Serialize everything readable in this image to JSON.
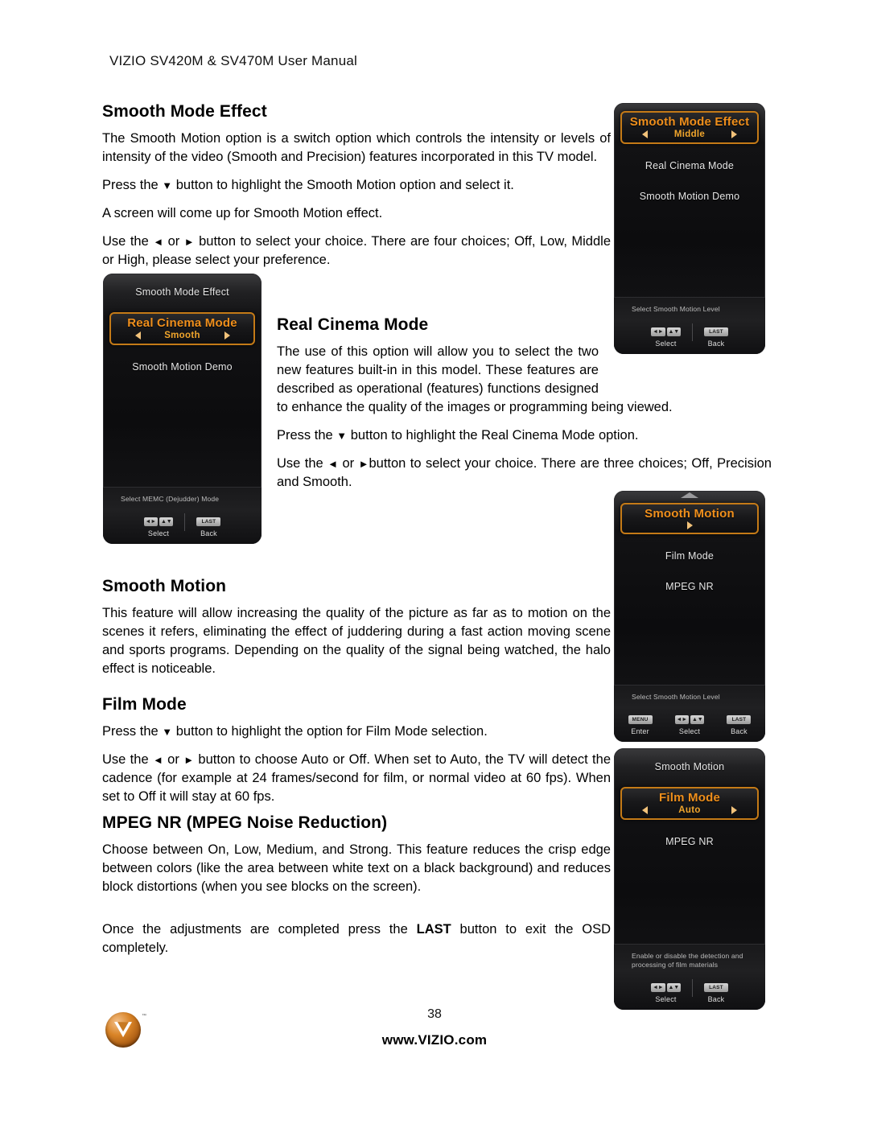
{
  "header": {
    "title": "VIZIO SV420M & SV470M User Manual"
  },
  "sections": {
    "smooth_mode_effect": {
      "heading": "Smooth Mode Effect",
      "p1": "The Smooth Motion option is a switch option which controls the intensity or levels of intensity of the video (Smooth and Precision) features incorporated in this TV model.",
      "p2_pre": "Press the ",
      "p2_post": " button to highlight the Smooth Motion option and select it.",
      "p3": "A screen will come up for Smooth Motion effect.",
      "p4_pre": "Use the ",
      "p4_mid": " or ",
      "p4_post": " button to select your choice. There are four choices; Off, Low, Middle or High, please select your preference."
    },
    "real_cinema_mode": {
      "heading": "Real Cinema Mode",
      "p1": "The use of this option will allow you to select the two new features built-in in this model. These features are described as operational (features) functions designed to enhance the quality of the images or programming being viewed.",
      "p2_pre": "Press the ",
      "p2_post": " button to highlight the Real Cinema Mode option.",
      "p3_pre": "Use the ",
      "p3_mid": " or ",
      "p3_post": "button to select your choice. There are three choices; Off, Precision and Smooth."
    },
    "smooth_motion": {
      "heading": "Smooth Motion",
      "p1": "This feature will allow increasing the quality of the picture as far as to motion on the scenes it refers, eliminating the effect of juddering during a fast action moving scene and sports programs. Depending on the quality of the signal being watched, the halo effect is noticeable."
    },
    "film_mode": {
      "heading": "Film Mode",
      "p1_pre": "Press the ",
      "p1_post": " button to highlight the option for Film Mode selection.",
      "p2_pre": "Use the ",
      "p2_mid": " or ",
      "p2_post": " button to choose Auto or Off. When set to Auto, the TV will detect the cadence (for example at 24 frames/second for film, or normal video at 60 fps). When set to Off it will stay at 60 fps."
    },
    "mpeg_nr": {
      "heading": "MPEG NR (MPEG Noise Reduction)",
      "p1": "Choose between On, Low, Medium, and Strong. This feature reduces the crisp edge between colors (like the area between white text on a black background) and reduces block distortions (when you see blocks on the screen).",
      "p2_pre": "Once the adjustments are completed press the ",
      "p2_bold": "LAST",
      "p2_post": " button to exit the OSD completely."
    }
  },
  "glyphs": {
    "down_triangle": "▼",
    "left_triangle": "◄",
    "right_triangle": "►"
  },
  "osd_panels": {
    "smooth_mode_effect": {
      "rows_before": [],
      "highlight": {
        "title": "Smooth Mode Effect",
        "value": "Middle",
        "has_left_arrow": true,
        "has_right_arrow": true
      },
      "rows_after": [
        "Real Cinema Mode",
        "Smooth Motion Demo"
      ],
      "hint": "Select Smooth Motion Level",
      "keys": [
        {
          "caps": [
            "◄►",
            "▲▼"
          ],
          "label": "Select"
        },
        {
          "caps": [
            "LAST"
          ],
          "label": "Back",
          "wide": true
        }
      ],
      "show_up_chevron": false
    },
    "real_cinema_mode": {
      "rows_before": [
        "Smooth Mode Effect"
      ],
      "highlight": {
        "title": "Real Cinema Mode",
        "value": "Smooth",
        "has_left_arrow": true,
        "has_right_arrow": true
      },
      "rows_after": [
        "Smooth Motion Demo"
      ],
      "hint": "Select MEMC (Dejudder) Mode",
      "keys": [
        {
          "caps": [
            "◄►",
            "▲▼"
          ],
          "label": "Select"
        },
        {
          "caps": [
            "LAST"
          ],
          "label": "Back",
          "wide": true
        }
      ],
      "show_up_chevron": false
    },
    "smooth_motion": {
      "rows_before": [],
      "highlight": {
        "title": "Smooth Motion",
        "value": "",
        "has_left_arrow": false,
        "has_right_arrow": true
      },
      "rows_after": [
        "Film Mode",
        "MPEG NR"
      ],
      "hint": "Select Smooth Motion Level",
      "keys": [
        {
          "caps": [
            "MENU"
          ],
          "label": "Enter",
          "wide": true
        },
        {
          "caps": [
            "◄►",
            "▲▼"
          ],
          "label": "Select"
        },
        {
          "caps": [
            "LAST"
          ],
          "label": "Back",
          "wide": true
        }
      ],
      "show_up_chevron": true
    },
    "film_mode": {
      "rows_before": [
        "Smooth Motion"
      ],
      "highlight": {
        "title": "Film Mode",
        "value": "Auto",
        "has_left_arrow": true,
        "has_right_arrow": true
      },
      "rows_after": [
        "MPEG NR"
      ],
      "hint": "Enable or disable the detection and processing of film materials",
      "keys": [
        {
          "caps": [
            "◄►",
            "▲▼"
          ],
          "label": "Select"
        },
        {
          "caps": [
            "LAST"
          ],
          "label": "Back",
          "wide": true
        }
      ],
      "show_up_chevron": false
    }
  },
  "footer": {
    "page_number": "38",
    "site": "www.VIZIO.com",
    "logo_tm": "™"
  },
  "colors": {
    "osd_accent": "#ef8f1c",
    "osd_value": "#f0a52c",
    "osd_border": "#c47a17",
    "brand_orange": "#d98427"
  }
}
